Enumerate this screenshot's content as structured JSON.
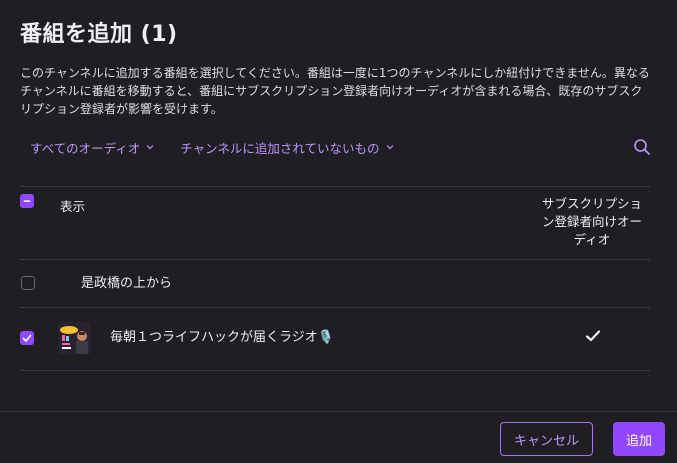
{
  "dialog": {
    "title": "番組を追加 (1)",
    "description": "このチャンネルに追加する番組を選択してください。番組は一度に1つのチャンネルにしか紐付けできません。異なるチャンネルに番組を移動すると、番組にサブスクリプション登録者向けオーディオが含まれる場合、既存のサブスクリプション登録者が影響を受けます。"
  },
  "filters": {
    "audio_filter": "すべてのオーディオ",
    "channel_filter": "チャンネルに追加されていないもの"
  },
  "table": {
    "header": {
      "label": "表示",
      "subscriber_col": "サブスクリプション登録者向けオーディオ",
      "select_all_state": "indeterminate"
    },
    "rows": [
      {
        "title": "是政橋の上から",
        "checked": false,
        "has_thumbnail": false,
        "subscriber_only": false
      },
      {
        "title": "毎朝１つライフハックが届くラジオ🎙️",
        "checked": true,
        "has_thumbnail": true,
        "subscriber_only": true
      }
    ]
  },
  "footer": {
    "cancel_label": "キャンセル",
    "add_label": "追加"
  },
  "colors": {
    "accent": "#9147ff",
    "link": "#bf94ff",
    "background": "#1f1f23"
  }
}
